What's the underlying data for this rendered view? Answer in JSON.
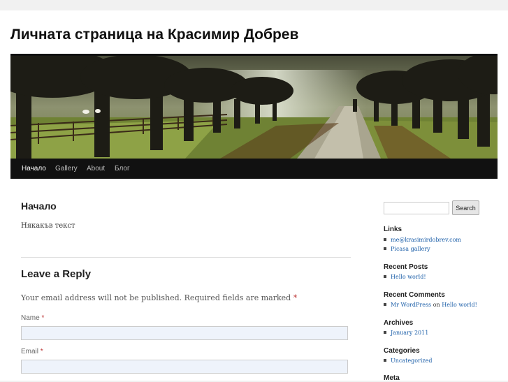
{
  "site": {
    "title": "Личната страница на Красимир Добрев"
  },
  "nav": {
    "items": [
      {
        "label": "Начало"
      },
      {
        "label": "Gallery"
      },
      {
        "label": "About"
      },
      {
        "label": "Блог"
      }
    ]
  },
  "post": {
    "title": "Начало",
    "text": "Някакъв текст"
  },
  "reply": {
    "title": "Leave a Reply",
    "note": "Your email address will not be published. Required fields are marked",
    "required_mark": "*",
    "fields": [
      {
        "label": "Name",
        "value": ""
      },
      {
        "label": "Email",
        "value": ""
      }
    ]
  },
  "sidebar": {
    "search_button": "Search",
    "search_value": "",
    "links_title": "Links",
    "links": [
      "me@krasimirdobrev.com",
      "Picasa gallery"
    ],
    "recent_posts_title": "Recent Posts",
    "recent_posts": [
      "Hello world!"
    ],
    "recent_comments_title": "Recent Comments",
    "recent_comment": {
      "author": "Mr WordPress",
      "on": "on",
      "post": "Hello world!"
    },
    "archives_title": "Archives",
    "archives": [
      "January 2011"
    ],
    "categories_title": "Categories",
    "categories": [
      "Uncategorized"
    ],
    "meta_title": "Meta"
  },
  "colors": {
    "nav_background": "#111111",
    "link": "#1b5ea8",
    "required": "#bb3333",
    "input_background": "#eef3fb"
  }
}
